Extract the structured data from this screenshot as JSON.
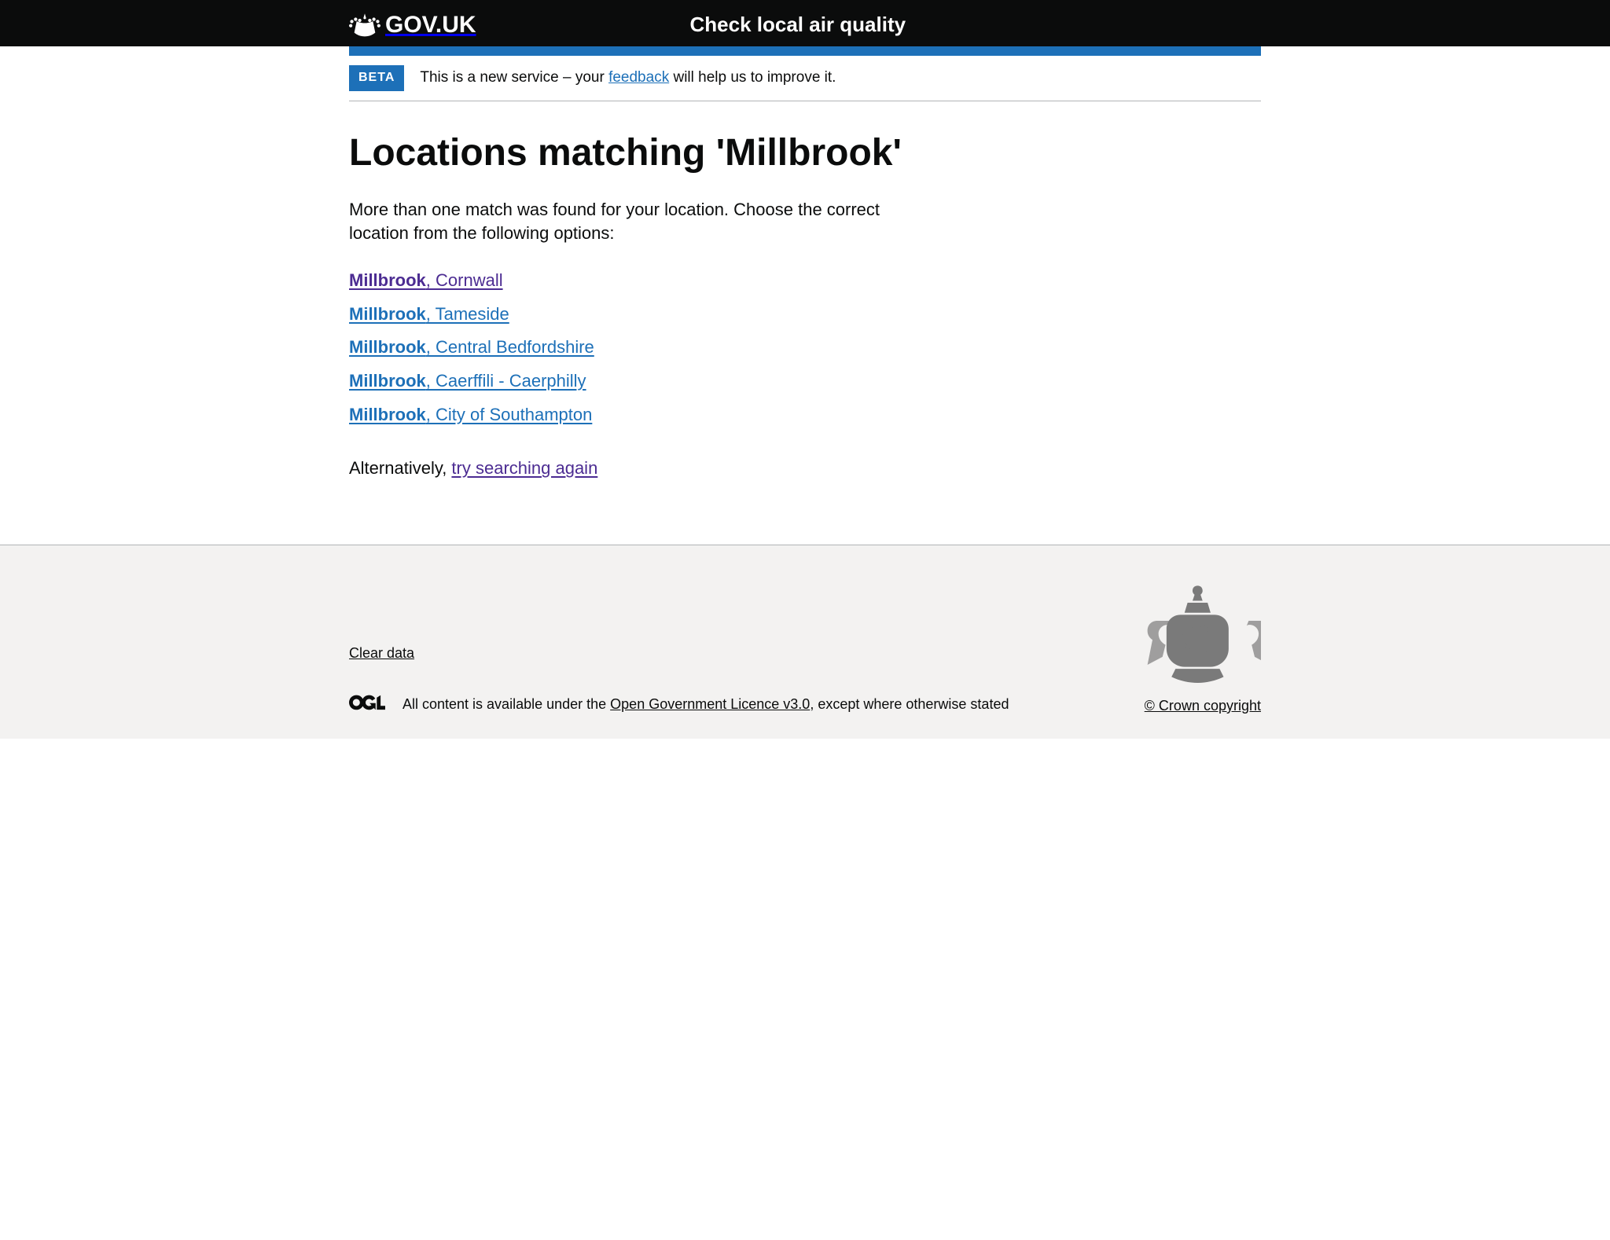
{
  "header": {
    "logotype": "GOV.UK",
    "service_name": "Check local air quality"
  },
  "phase_banner": {
    "tag": "BETA",
    "text_before": "This is a new service – your ",
    "feedback_link": "feedback",
    "text_after": " will help us to improve it."
  },
  "page": {
    "heading": "Locations matching 'Millbrook'",
    "intro": "More than one match was found for your location. Choose the correct location from the following options:",
    "results": [
      {
        "name": "Millbrook",
        "suffix": ", Cornwall",
        "visited": true
      },
      {
        "name": "Millbrook",
        "suffix": ", Tameside",
        "visited": false
      },
      {
        "name": "Millbrook",
        "suffix": ", Central Bedfordshire",
        "visited": false
      },
      {
        "name": "Millbrook",
        "suffix": ", Caerffili - Caerphilly",
        "visited": false
      },
      {
        "name": "Millbrook",
        "suffix": ", City of Southampton",
        "visited": false
      }
    ],
    "alt_text_before": "Alternatively, ",
    "alt_link": "try searching again"
  },
  "footer": {
    "clear_data": "Clear data",
    "licence_before": "All content is available under the ",
    "licence_link": "Open Government Licence v3.0",
    "licence_after": ", except where otherwise stated",
    "crown_copyright": "© Crown copyright"
  }
}
